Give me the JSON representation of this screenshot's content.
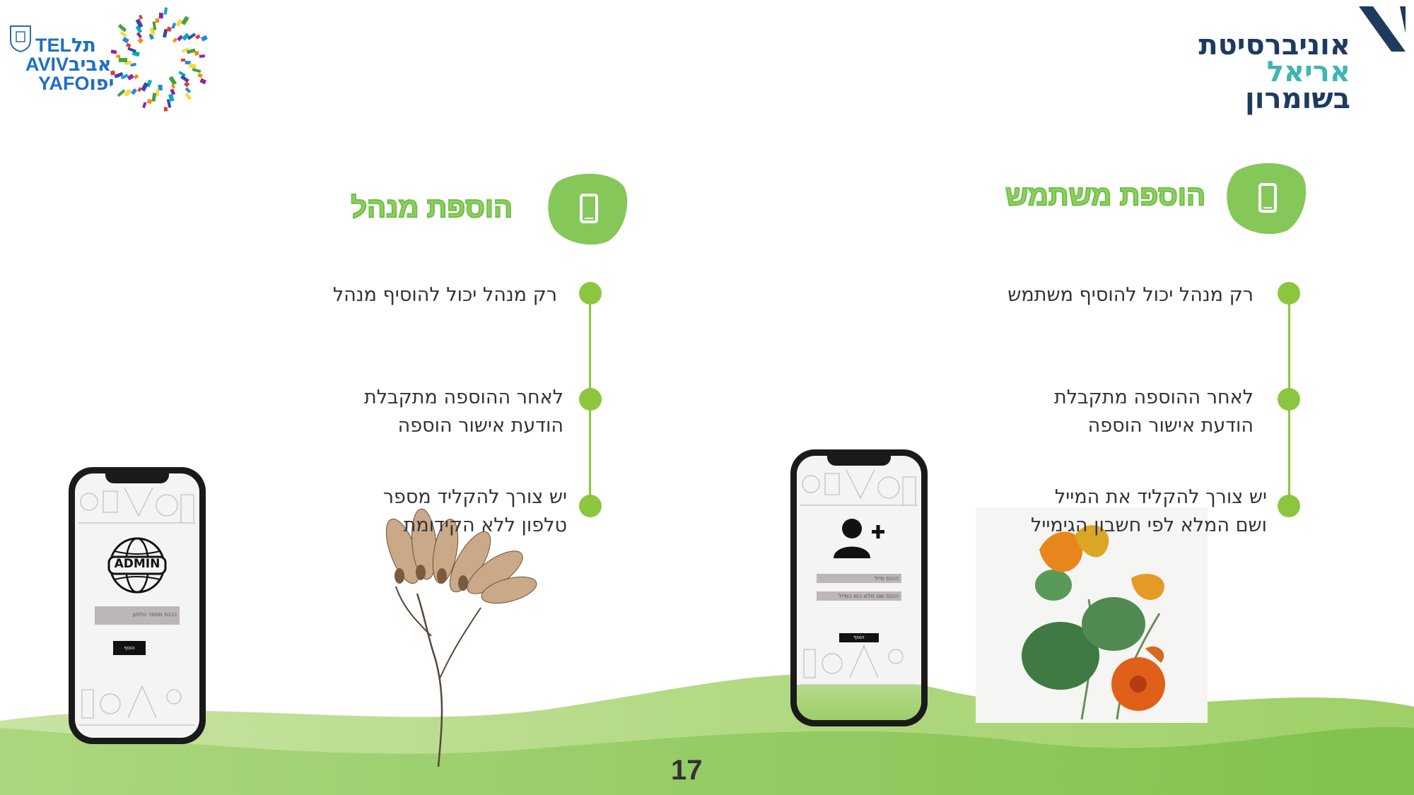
{
  "logos": {
    "tlv": {
      "line1": "תל",
      "line1_en": "TEL",
      "line2": "אביב",
      "line2_en": "AVIV",
      "line3": "יפו",
      "line3_en": "YAFO"
    },
    "university": {
      "line1": "אוניברסיטת",
      "line2": "אריאל",
      "line3": "בשומרון"
    }
  },
  "sections": [
    {
      "title": "הוספת משתמש",
      "items": [
        {
          "lines": [
            "רק מנהל יכול להוסיף משתמש"
          ]
        },
        {
          "lines": [
            "לאחר ההוספה מתקבלת",
            "הודעת אישור הוספה"
          ]
        },
        {
          "lines": [
            "יש צורך להקליד את המייל",
            "ושם המלא לפי חשבון הגימייל"
          ]
        }
      ],
      "phone": {
        "field1": "הכנס מייל",
        "field2": "הכנס שם מלא כמו המייל",
        "button": "הוסף"
      }
    },
    {
      "title": "הוספת מנהל",
      "items": [
        {
          "lines": [
            "רק מנהל יכול להוסיף מנהל"
          ]
        },
        {
          "lines": [
            "לאחר ההוספה מתקבלת",
            "הודעת אישור הוספה"
          ]
        },
        {
          "lines": [
            "יש צורך להקליד מספר",
            "טלפון ללא הקידומת"
          ]
        }
      ],
      "phone": {
        "badge": "ADMIN",
        "field1": "הכנס מספר טלפון",
        "button": "הוסף"
      }
    }
  ],
  "page_number": "17",
  "colors": {
    "accent": "#8cc63f",
    "title": "#8fcf62",
    "university_dark": "#1e3a5f",
    "university_green": "#3db7b0"
  },
  "icons": [
    "phone-icon",
    "add-user-icon",
    "globe-icon",
    "tlv-burst-logo",
    "ariel-logo-mark"
  ]
}
